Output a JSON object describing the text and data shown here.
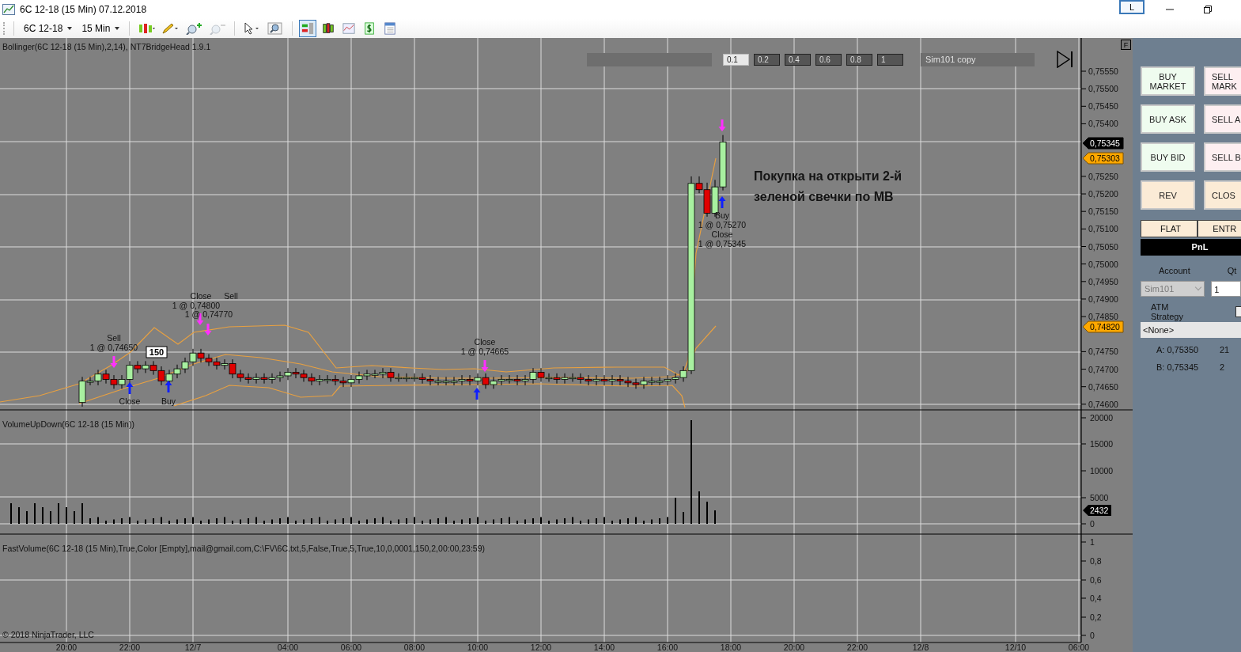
{
  "window": {
    "title": "6C 12-18 (15 Min)  07.12.2018",
    "layout_button": "L"
  },
  "toolbar": {
    "instrument": "6C 12-18",
    "interval": "15 Min",
    "tools": [
      {
        "kind": "candles",
        "disabled": false
      },
      {
        "kind": "pencil",
        "disabled": false
      },
      {
        "kind": "zoom_in",
        "disabled": false
      },
      {
        "kind": "zoom_out",
        "disabled": true
      },
      {
        "kind": "pointer",
        "disabled": false
      },
      {
        "kind": "magnifier",
        "disabled": false
      }
    ],
    "toggles": [
      {
        "kind": "order_panel",
        "selected": true
      },
      {
        "kind": "candles",
        "selected": false
      },
      {
        "kind": "chart",
        "selected": false
      },
      {
        "kind": "dollar",
        "selected": false
      },
      {
        "kind": "table",
        "selected": false
      }
    ]
  },
  "price_panel": {
    "indicator_label": "Bollinger(6C 12-18 (15 Min),2,14), NT7BridgeHead 1.9.1",
    "quantity_buttons": [
      {
        "label": "0.1",
        "selected": true
      },
      {
        "label": "0.2",
        "selected": false
      },
      {
        "label": "0.4",
        "selected": false
      },
      {
        "label": "0.6",
        "selected": false
      },
      {
        "label": "0.8",
        "selected": false
      },
      {
        "label": "1",
        "selected": false
      }
    ],
    "account_field": "Sim101 copy",
    "panel_button": "F",
    "axis_labels": [
      "0,75550",
      "0,75500",
      "0,75450",
      "0,75400",
      "0,75250",
      "0,75200",
      "0,75150",
      "0,75100",
      "0,75050",
      "0,75000",
      "0,74950",
      "0,74900",
      "0,74850",
      "0,74750",
      "0,74700",
      "0,74650",
      "0,74600"
    ],
    "price_flags": [
      {
        "label": "0,75345",
        "kind": "last"
      },
      {
        "label": "0,75303",
        "kind": "level"
      },
      {
        "label": "0,74820",
        "kind": "level"
      }
    ],
    "trade_labels": [
      "Sell",
      "1 @ 0,74650",
      "Close",
      "Buy",
      "Close",
      "1 @ 0,74800",
      "Sell",
      "1 @ 0,74770",
      "Close",
      "1 @ 0,74665",
      "Buy",
      "1 @ 0,75270",
      "Close",
      "1 @ 0,75345"
    ],
    "count_label": "150",
    "annotation": [
      "Покупка на открыти  2-й",
      "зеленой свечки по МВ"
    ]
  },
  "volume_panel": {
    "indicator_label": "VolumeUpDown(6C 12-18 (15 Min))",
    "axis_labels": [
      "20000",
      "15000",
      "10000",
      "5000",
      "0"
    ],
    "last_value": "2432"
  },
  "fast_volume_panel": {
    "indicator_label": "FastVolume(6C 12-18 (15 Min),True,Color [Empty],mail@gmail.com,C:\\FV\\6C.txt,5,False,True,5,True,10,0,0001,150,2,00:00,23:59)",
    "axis_labels": [
      "1",
      "0,8",
      "0,6",
      "0,4",
      "0,2",
      "0"
    ],
    "copyright": "© 2018 NinjaTrader, LLC"
  },
  "time_axis": [
    "20:00",
    "22:00",
    "12/7",
    "04:00",
    "06:00",
    "08:00",
    "10:00",
    "12:00",
    "14:00",
    "16:00",
    "18:00",
    "20:00",
    "22:00",
    "12/8",
    "12/10",
    "06:00"
  ],
  "order_panel": {
    "buttons": [
      {
        "label": "BUY MARKET",
        "kind": "buy"
      },
      {
        "label": "SELL MARK",
        "kind": "sell"
      },
      {
        "label": "BUY ASK",
        "kind": "buy"
      },
      {
        "label": "SELL A",
        "kind": "sell"
      },
      {
        "label": "BUY BID",
        "kind": "buy"
      },
      {
        "label": "SELL B",
        "kind": "sell"
      },
      {
        "label": "REV",
        "kind": "neutral"
      },
      {
        "label": "CLOS",
        "kind": "neutral"
      }
    ],
    "position_tabs": [
      "FLAT",
      "ENTR"
    ],
    "pnl": "PnL",
    "account_label": "Account",
    "qty_label": "Qt",
    "account": {
      "value": "Sim101",
      "disabled": true
    },
    "qty": "1",
    "atm_label": "ATM Strategy",
    "atm_checkbox": {
      "checked": false
    },
    "atm": "<None>",
    "quotes": [
      {
        "label": "A: 0,75350",
        "size": "21"
      },
      {
        "label": "B: 0,75345",
        "size": "2"
      }
    ]
  }
}
